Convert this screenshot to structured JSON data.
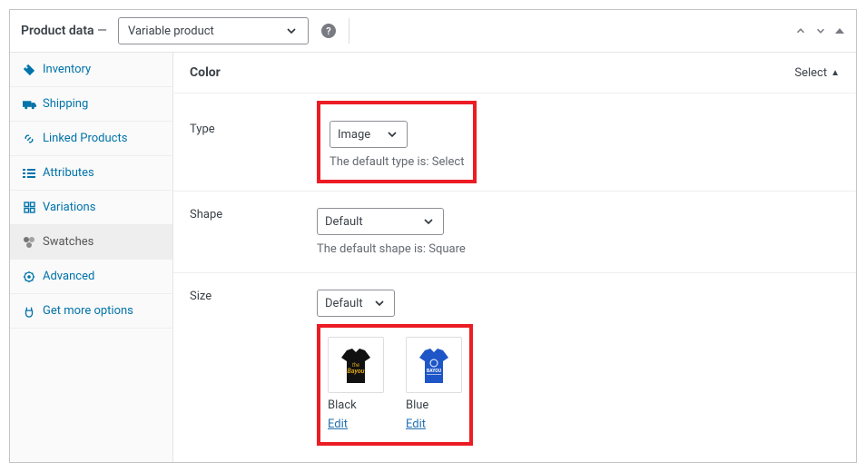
{
  "header": {
    "title": "Product data",
    "dash": " — ",
    "product_type": "Variable product"
  },
  "sidebar": {
    "items": [
      {
        "label": "Inventory",
        "icon": "tag"
      },
      {
        "label": "Shipping",
        "icon": "truck"
      },
      {
        "label": "Linked Products",
        "icon": "link"
      },
      {
        "label": "Attributes",
        "icon": "list"
      },
      {
        "label": "Variations",
        "icon": "grid"
      },
      {
        "label": "Swatches",
        "icon": "swatch",
        "active": true
      },
      {
        "label": "Advanced",
        "icon": "gear"
      },
      {
        "label": "Get more options",
        "icon": "plugin"
      }
    ]
  },
  "attribute": {
    "name": "Color",
    "select_label": "Select",
    "rows": {
      "type": {
        "label": "Type",
        "value": "Image",
        "help": "The default type is: Select"
      },
      "shape": {
        "label": "Shape",
        "value": "Default",
        "help": "The default shape is: Square"
      },
      "size": {
        "label": "Size",
        "value": "Default"
      }
    },
    "swatches": [
      {
        "name": "Black",
        "edit": "Edit",
        "color_primary": "#111111",
        "color_print": "#d4a018"
      },
      {
        "name": "Blue",
        "edit": "Edit",
        "color_primary": "#1e56c7",
        "color_print": "#ffffff"
      }
    ]
  }
}
